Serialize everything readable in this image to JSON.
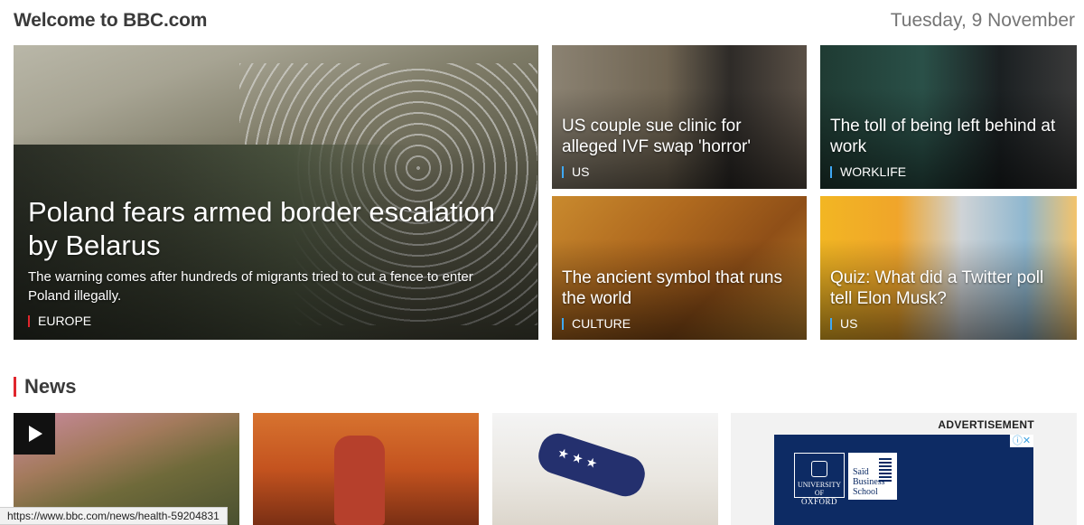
{
  "header": {
    "welcome": "Welcome to BBC.com",
    "date": "Tuesday, 9 November"
  },
  "hero": {
    "title": "Poland fears armed border escalation by Belarus",
    "summary": "The warning comes after hundreds of migrants tried to cut a fence to enter Poland illegally.",
    "tag": "EUROPE",
    "tag_color": "#e0262d"
  },
  "cards": [
    {
      "title": "US couple sue clinic for alleged IVF swap 'horror'",
      "tag": "US"
    },
    {
      "title": "The toll of being left behind at work",
      "tag": "WORKLIFE"
    },
    {
      "title": "The ancient symbol that runs the world",
      "tag": "CULTURE"
    },
    {
      "title": "Quiz: What did a Twitter poll tell Elon Musk?",
      "tag": "US"
    }
  ],
  "news": {
    "section_title": "News",
    "play_icon": "play-icon"
  },
  "ad": {
    "label": "ADVERTISEMENT",
    "close_glyph": "ⓘ✕",
    "oxford_top": "UNIVERSITY OF",
    "oxford_name": "OXFORD",
    "said_text": "Saïd Business School"
  },
  "status_url": "https://www.bbc.com/news/health-59204831",
  "colors": {
    "accent_red": "#e0262d",
    "tag_blue": "#3fa9f5",
    "ad_navy": "#0d2b64"
  }
}
